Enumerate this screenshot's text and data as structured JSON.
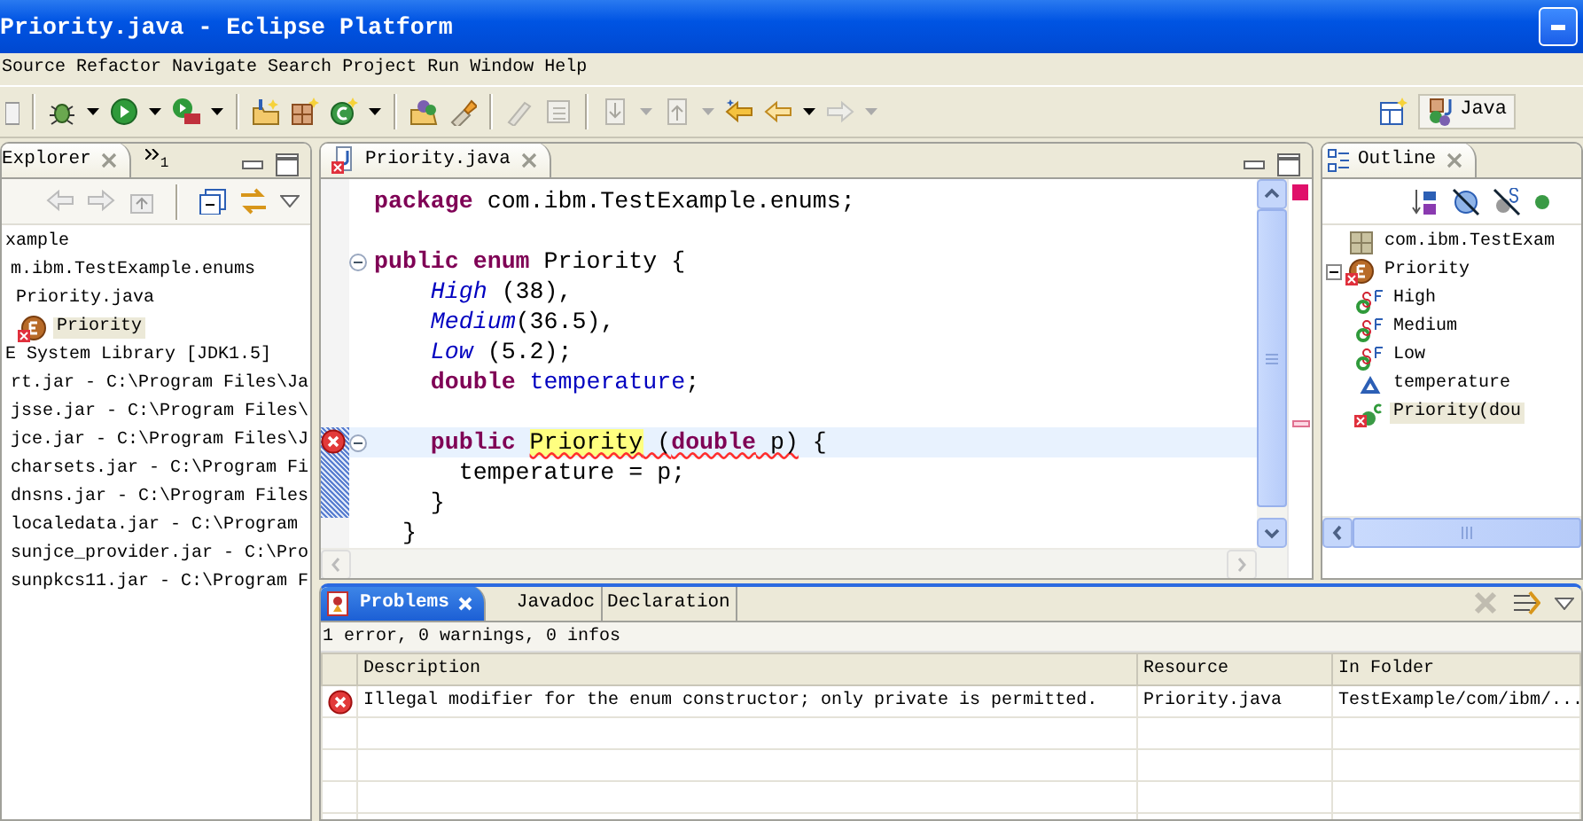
{
  "window": {
    "title": "Priority.java - Eclipse Platform"
  },
  "menu": [
    "Source",
    "Refactor",
    "Navigate",
    "Search",
    "Project",
    "Run",
    "Window",
    "Help"
  ],
  "perspective": {
    "label": "Java"
  },
  "explorer": {
    "tab": "Explorer",
    "overflow_count": "1",
    "tree": [
      {
        "text": "xample",
        "selected": false,
        "children": [
          {
            "text": "m.ibm.TestExample.enums",
            "selected": false,
            "children": [
              {
                "text": "Priority.java",
                "selected": false,
                "children": [
                  {
                    "kind": "enum",
                    "text": "Priority",
                    "selected": true,
                    "error": true
                  }
                ]
              }
            ]
          }
        ]
      },
      {
        "text": "E System Library [JDK1.5]",
        "selected": false,
        "children": [
          {
            "text": "rt.jar - C:\\Program Files\\Ja",
            "selected": false
          },
          {
            "text": "jsse.jar - C:\\Program Files\\",
            "selected": false
          },
          {
            "text": "jce.jar - C:\\Program Files\\J",
            "selected": false
          },
          {
            "text": "charsets.jar - C:\\Program Fi",
            "selected": false
          },
          {
            "text": "dnsns.jar - C:\\Program Files",
            "selected": false
          },
          {
            "text": "localedata.jar - C:\\Program",
            "selected": false
          },
          {
            "text": "sunjce_provider.jar - C:\\Pro",
            "selected": false
          },
          {
            "text": "sunpkcs11.jar - C:\\Program F",
            "selected": false
          }
        ]
      }
    ]
  },
  "editor": {
    "tab": {
      "label": "Priority.java",
      "error": true
    },
    "lines": [
      {
        "kind": "code",
        "fold": false,
        "error": false,
        "current": false,
        "range": false,
        "tokens": [
          {
            "kind": "keyword",
            "text": "package"
          },
          {
            "kind": "plain",
            "text": " com.ibm.TestExample.enums;"
          }
        ]
      },
      {
        "kind": "blank"
      },
      {
        "kind": "code",
        "fold": true,
        "error": false,
        "current": false,
        "range": false,
        "tokens": [
          {
            "kind": "keyword",
            "text": "public enum"
          },
          {
            "kind": "plain",
            "text": " Priority {"
          }
        ]
      },
      {
        "kind": "code",
        "fold": false,
        "error": false,
        "current": false,
        "range": false,
        "tokens": [
          {
            "kind": "enum_constant",
            "text": "    High"
          },
          {
            "kind": "plain",
            "text": " (38),"
          }
        ]
      },
      {
        "kind": "code",
        "fold": false,
        "error": false,
        "current": false,
        "range": false,
        "tokens": [
          {
            "kind": "enum_constant",
            "text": "    Medium"
          },
          {
            "kind": "plain",
            "text": "(36.5),"
          }
        ]
      },
      {
        "kind": "code",
        "fold": false,
        "error": false,
        "current": false,
        "range": false,
        "tokens": [
          {
            "kind": "enum_constant",
            "text": "    Low"
          },
          {
            "kind": "plain",
            "text": " (5.2);"
          }
        ]
      },
      {
        "kind": "code",
        "fold": false,
        "error": false,
        "current": false,
        "range": false,
        "tokens": [
          {
            "kind": "keyword",
            "text": "    double"
          },
          {
            "kind": "field",
            "text": " temperature"
          },
          {
            "kind": "plain",
            "text": ";"
          }
        ]
      },
      {
        "kind": "blank"
      },
      {
        "kind": "code",
        "fold": true,
        "error": true,
        "current": true,
        "range": true,
        "tokens": [
          {
            "kind": "keyword",
            "text": "    public "
          },
          {
            "kind": "plain",
            "text": "Priority",
            "highlight": true,
            "squiggle": true
          },
          {
            "kind": "plain",
            "text": " (",
            "squiggle": true
          },
          {
            "kind": "keyword",
            "text": "double",
            "squiggle": true
          },
          {
            "kind": "plain",
            "text": " p)",
            "squiggle": true
          },
          {
            "kind": "plain",
            "text": " {"
          }
        ]
      },
      {
        "kind": "code",
        "fold": false,
        "error": false,
        "current": false,
        "range": true,
        "tokens": [
          {
            "kind": "plain",
            "text": "      temperature = p;"
          }
        ]
      },
      {
        "kind": "code",
        "fold": false,
        "error": false,
        "current": false,
        "range": true,
        "tokens": [
          {
            "kind": "plain",
            "text": "    }"
          }
        ]
      },
      {
        "kind": "code",
        "fold": false,
        "error": false,
        "current": false,
        "range": false,
        "tokens": [
          {
            "kind": "plain",
            "text": "  }"
          }
        ]
      }
    ]
  },
  "outline": {
    "tab": "Outline",
    "tree": [
      {
        "kind": "package",
        "text": "com.ibm.TestExam",
        "selected": false,
        "error": false
      },
      {
        "kind": "enum",
        "text": "Priority",
        "selected": false,
        "error": true,
        "expanded": true,
        "children": [
          {
            "kind": "constant",
            "text": "High",
            "selected": false,
            "error": false
          },
          {
            "kind": "constant",
            "text": "Medium",
            "selected": false,
            "error": false
          },
          {
            "kind": "constant",
            "text": "Low",
            "selected": false,
            "error": false
          },
          {
            "kind": "field",
            "text": "temperature",
            "selected": false,
            "error": false
          },
          {
            "kind": "constructor",
            "text": "Priority(dou",
            "selected": true,
            "error": true
          }
        ]
      }
    ]
  },
  "problems": {
    "tabs": [
      {
        "label": "Problems",
        "selected": true
      },
      {
        "label": "Javadoc",
        "selected": false
      },
      {
        "label": "Declaration",
        "selected": false
      }
    ],
    "summary": "1 error, 0 warnings, 0 infos",
    "columns": [
      "Description",
      "Resource",
      "In Folder"
    ],
    "rows": [
      {
        "kind": "error",
        "cells": [
          "Illegal modifier for the enum constructor; only private is permitted.",
          "Priority.java",
          "TestExample/com/ibm/..."
        ]
      }
    ]
  }
}
